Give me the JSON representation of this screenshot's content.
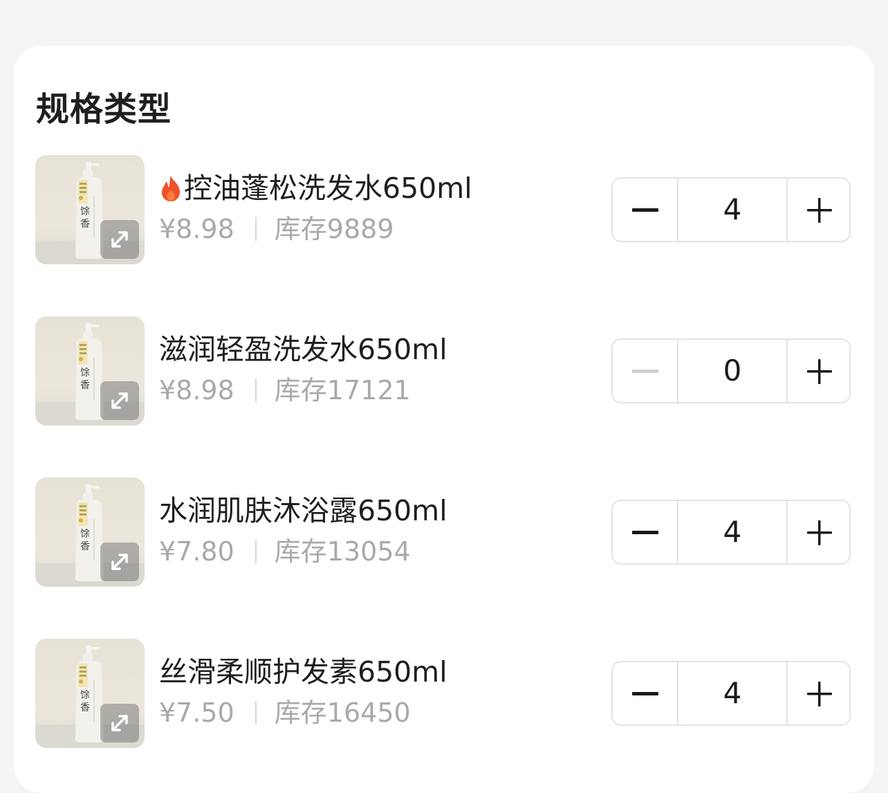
{
  "section": {
    "title": "规格类型"
  },
  "items": [
    {
      "name": "控油蓬松洗发水650ml",
      "hot": true,
      "price": "¥8.98",
      "stock": "库存9889",
      "quantity": "4",
      "minus_enabled": true
    },
    {
      "name": "滋润轻盈洗发水650ml",
      "hot": false,
      "price": "¥8.98",
      "stock": "库存17121",
      "quantity": "0",
      "minus_enabled": false
    },
    {
      "name": "水润肌肤沐浴露650ml",
      "hot": false,
      "price": "¥7.80",
      "stock": "库存13054",
      "quantity": "4",
      "minus_enabled": true
    },
    {
      "name": "丝滑柔顺护发素650ml",
      "hot": false,
      "price": "¥7.50",
      "stock": "库存16450",
      "quantity": "4",
      "minus_enabled": true
    }
  ],
  "icons": {
    "hot": "fire-icon",
    "expand": "expand-icon",
    "minus": "minus-icon",
    "plus": "plus-icon"
  },
  "colors": {
    "title_text": "#1f1f1f",
    "secondary_text": "#a9a9a9",
    "border": "#e3e3e3",
    "disabled_icon": "#d0d0d0",
    "fire": "#f0512a"
  }
}
